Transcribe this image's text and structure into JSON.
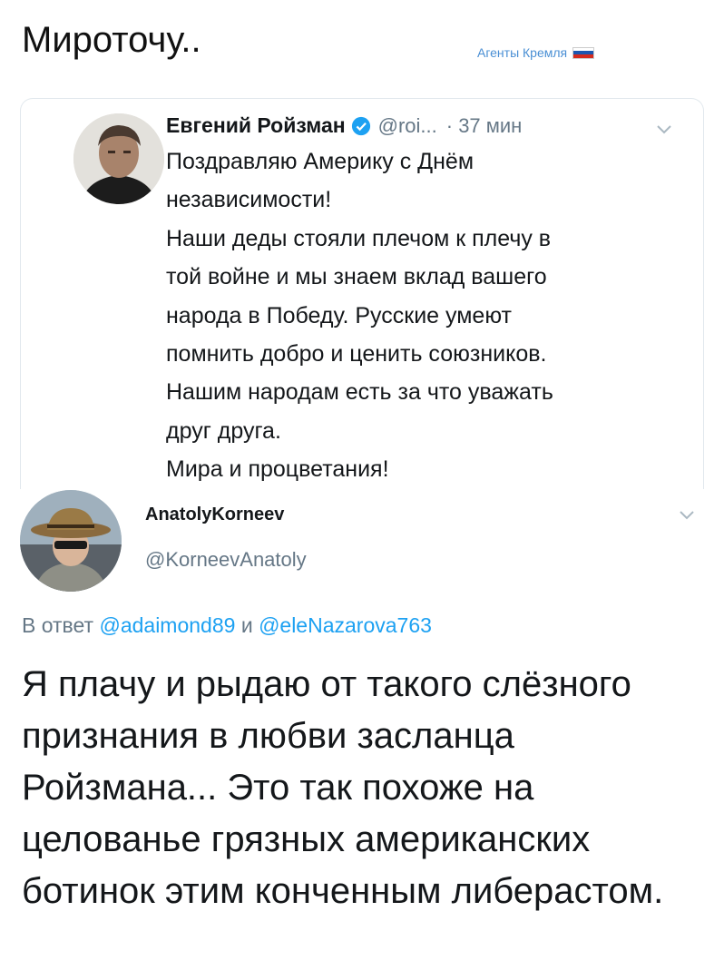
{
  "header": {
    "title": "Мироточу.."
  },
  "watermark": {
    "text": "Агенты Кремля"
  },
  "quoted_tweet": {
    "author_name": "Евгений Ройзман",
    "handle": "@roi...",
    "time": "· 37 мин",
    "text": "Поздравляю Америку с Днём\nнезависимости!\nНаши деды стояли плечом к плечу в\nтой войне и мы знаем вклад вашего\nнарода в Победу. Русские умеют\nпомнить добро и ценить союзников.\nНашим народам есть за что уважать\nдруг друга.\nМира и процветания!",
    "icons": {
      "verified": "verified-badge-icon",
      "menu": "chevron-down-icon"
    }
  },
  "reply_tweet": {
    "author_name": "AnatolyKorneev",
    "handle": "@KorneevAnatoly",
    "reply_prefix": "В ответ",
    "mention_1": "@adaimond89",
    "conjunction": "и",
    "mention_2": "@eleNazarova763",
    "text": "Я плачу и рыдаю от такого слёзного признания в любви засланца Ройзмана... Это так похоже на целованье грязных американских ботинок этим конченным либерастом."
  },
  "colors": {
    "link": "#1da1f2",
    "secondary": "#657786",
    "verified": "#1da1f2",
    "watermark": "#4a8fd4"
  }
}
